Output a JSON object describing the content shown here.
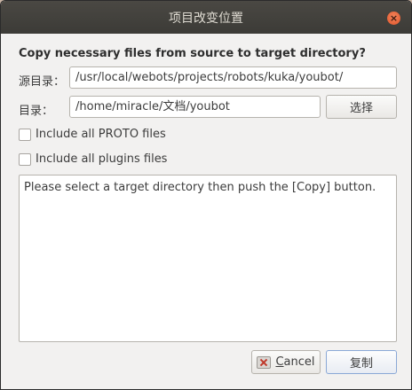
{
  "window": {
    "title": "项目改变位置",
    "close_icon": "×"
  },
  "dialog": {
    "heading": "Copy necessary files from source to target directory?",
    "source": {
      "label": "源目录：",
      "value": "/usr/local/webots/projects/robots/kuka/youbot/"
    },
    "target": {
      "label": "目录：",
      "value": "/home/miracle/文档/youbot",
      "select_button": "选择"
    },
    "options": [
      {
        "label": "Include all PROTO files",
        "checked": false
      },
      {
        "label": "Include all plugins files",
        "checked": false
      }
    ],
    "message": "Please select a target directory then push the [Copy] button.",
    "buttons": {
      "cancel_mnemonic": "C",
      "cancel_rest": "ancel",
      "cancel_icon": "cancel-icon",
      "copy": "复制"
    }
  }
}
